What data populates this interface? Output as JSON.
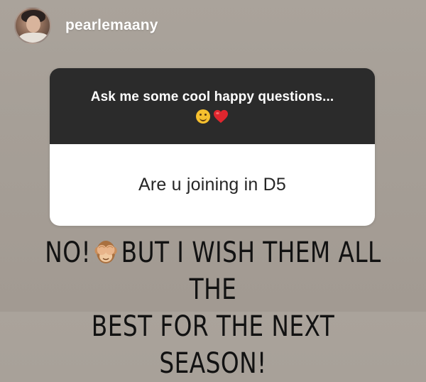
{
  "story": {
    "username": "pearlemaany",
    "avatar_icon": "profile-photo",
    "question_card": {
      "prompt": "Ask me some cool happy questions...",
      "prompt_emojis": [
        "smiling-face-emoji",
        "red-heart-emoji"
      ],
      "question": "Are u joining in D5",
      "colors": {
        "header_bg": "#2b2b2b",
        "body_bg": "#ffffff"
      }
    },
    "answer": {
      "line1_start": "NO!",
      "line1_emoji": "see-no-evil-monkey-emoji",
      "line1_end": "BUT I WISH THEM ALL THE",
      "line2": "BEST FOR THE NEXT SEASON!"
    }
  }
}
